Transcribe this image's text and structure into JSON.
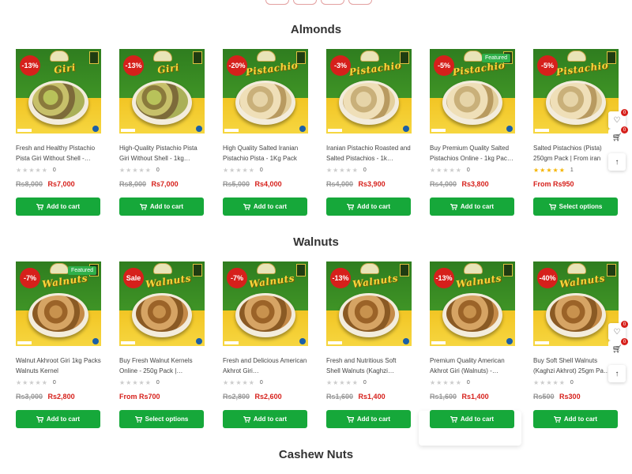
{
  "sections": [
    {
      "title": "Almonds",
      "products": [
        {
          "discount": "-13%",
          "featured": "",
          "name": "Fresh and Healthy Pistachio Pista Giri Without Shell -…",
          "rating_count": "0",
          "rated": false,
          "old_price": "Rs8,000",
          "new_price": "Rs7,000",
          "from_price": "",
          "button": "Add to cart",
          "brand": "Giri"
        },
        {
          "discount": "-13%",
          "featured": "",
          "name": "High-Quality Pistachio Pista Giri Without Shell - 1kg…",
          "rating_count": "0",
          "rated": false,
          "old_price": "Rs8,000",
          "new_price": "Rs7,000",
          "from_price": "",
          "button": "Add to cart",
          "brand": "Giri"
        },
        {
          "discount": "-20%",
          "featured": "",
          "name": "High Quality Salted Iranian Pistachio Pista - 1Kg Pack",
          "rating_count": "0",
          "rated": false,
          "old_price": "Rs5,000",
          "new_price": "Rs4,000",
          "from_price": "",
          "button": "Add to cart",
          "brand": "Pistachio"
        },
        {
          "discount": "-3%",
          "featured": "",
          "name": "Iranian Pistachio Roasted and Salted Pistachios - 1k…",
          "rating_count": "0",
          "rated": false,
          "old_price": "Rs4,000",
          "new_price": "Rs3,900",
          "from_price": "",
          "button": "Add to cart",
          "brand": "Pistachio"
        },
        {
          "discount": "-5%",
          "featured": "Featured",
          "name": "Buy Premium Quality Salted Pistachios Online - 1kg Pac…",
          "rating_count": "0",
          "rated": false,
          "old_price": "Rs4,000",
          "new_price": "Rs3,800",
          "from_price": "",
          "button": "Add to cart",
          "brand": "Pistachio"
        },
        {
          "discount": "-5%",
          "featured": "",
          "name": "Salted Pistachios (Pista) 250gm Pack | From iran",
          "rating_count": "1",
          "rated": true,
          "old_price": "",
          "new_price": "",
          "from_price": "From Rs950",
          "button": "Select options",
          "brand": "Pistachio"
        }
      ]
    },
    {
      "title": "Walnuts",
      "products": [
        {
          "discount": "-7%",
          "featured": "Featured",
          "name": "Walnut Akhroot Giri 1kg Packs Walnuts Kernel",
          "rating_count": "0",
          "rated": false,
          "old_price": "Rs3,000",
          "new_price": "Rs2,800",
          "from_price": "",
          "button": "Add to cart",
          "brand": "Walnuts"
        },
        {
          "discount": "Sale",
          "featured": "",
          "name": "Buy Fresh Walnut Kernels Online - 250g Pack |…",
          "rating_count": "0",
          "rated": false,
          "old_price": "",
          "new_price": "",
          "from_price": "From Rs700",
          "button": "Select options",
          "brand": "Walnuts"
        },
        {
          "discount": "-7%",
          "featured": "",
          "name": "Fresh and Delicious American Akhrot Giri…",
          "rating_count": "0",
          "rated": false,
          "old_price": "Rs2,800",
          "new_price": "Rs2,600",
          "from_price": "",
          "button": "Add to cart",
          "brand": "Walnuts"
        },
        {
          "discount": "-13%",
          "featured": "",
          "name": "Fresh and Nutritious Soft Shell Walnuts (Kaghzi…",
          "rating_count": "0",
          "rated": false,
          "old_price": "Rs1,600",
          "new_price": "Rs1,400",
          "from_price": "",
          "button": "Add to cart",
          "brand": "Walnuts"
        },
        {
          "discount": "-13%",
          "featured": "",
          "name": "Premium Quality American Akhrot Giri (Walnuts) -…",
          "rating_count": "0",
          "rated": false,
          "old_price": "Rs1,600",
          "new_price": "Rs1,400",
          "from_price": "",
          "button": "Add to cart",
          "brand": "Walnuts"
        },
        {
          "discount": "-40%",
          "featured": "",
          "name": "Buy Soft Shell Walnuts (Kaghzi Akhrot) 25gm Pa…",
          "rating_count": "0",
          "rated": false,
          "old_price": "Rs500",
          "new_price": "Rs300",
          "from_price": "",
          "button": "Add to cart",
          "brand": "Walnuts"
        }
      ]
    },
    {
      "title": "Cashew Nuts",
      "products": []
    }
  ],
  "floating": {
    "wishlist_count": "0",
    "cart_count": "0"
  },
  "colors": {
    "accent": "#16a83a",
    "discount": "#d6201b",
    "featured": "#2fb04a",
    "price_new": "#d6201b"
  },
  "icons": {
    "wishlist": "heart-icon",
    "cart": "cart-icon",
    "top": "arrow-up-icon"
  }
}
